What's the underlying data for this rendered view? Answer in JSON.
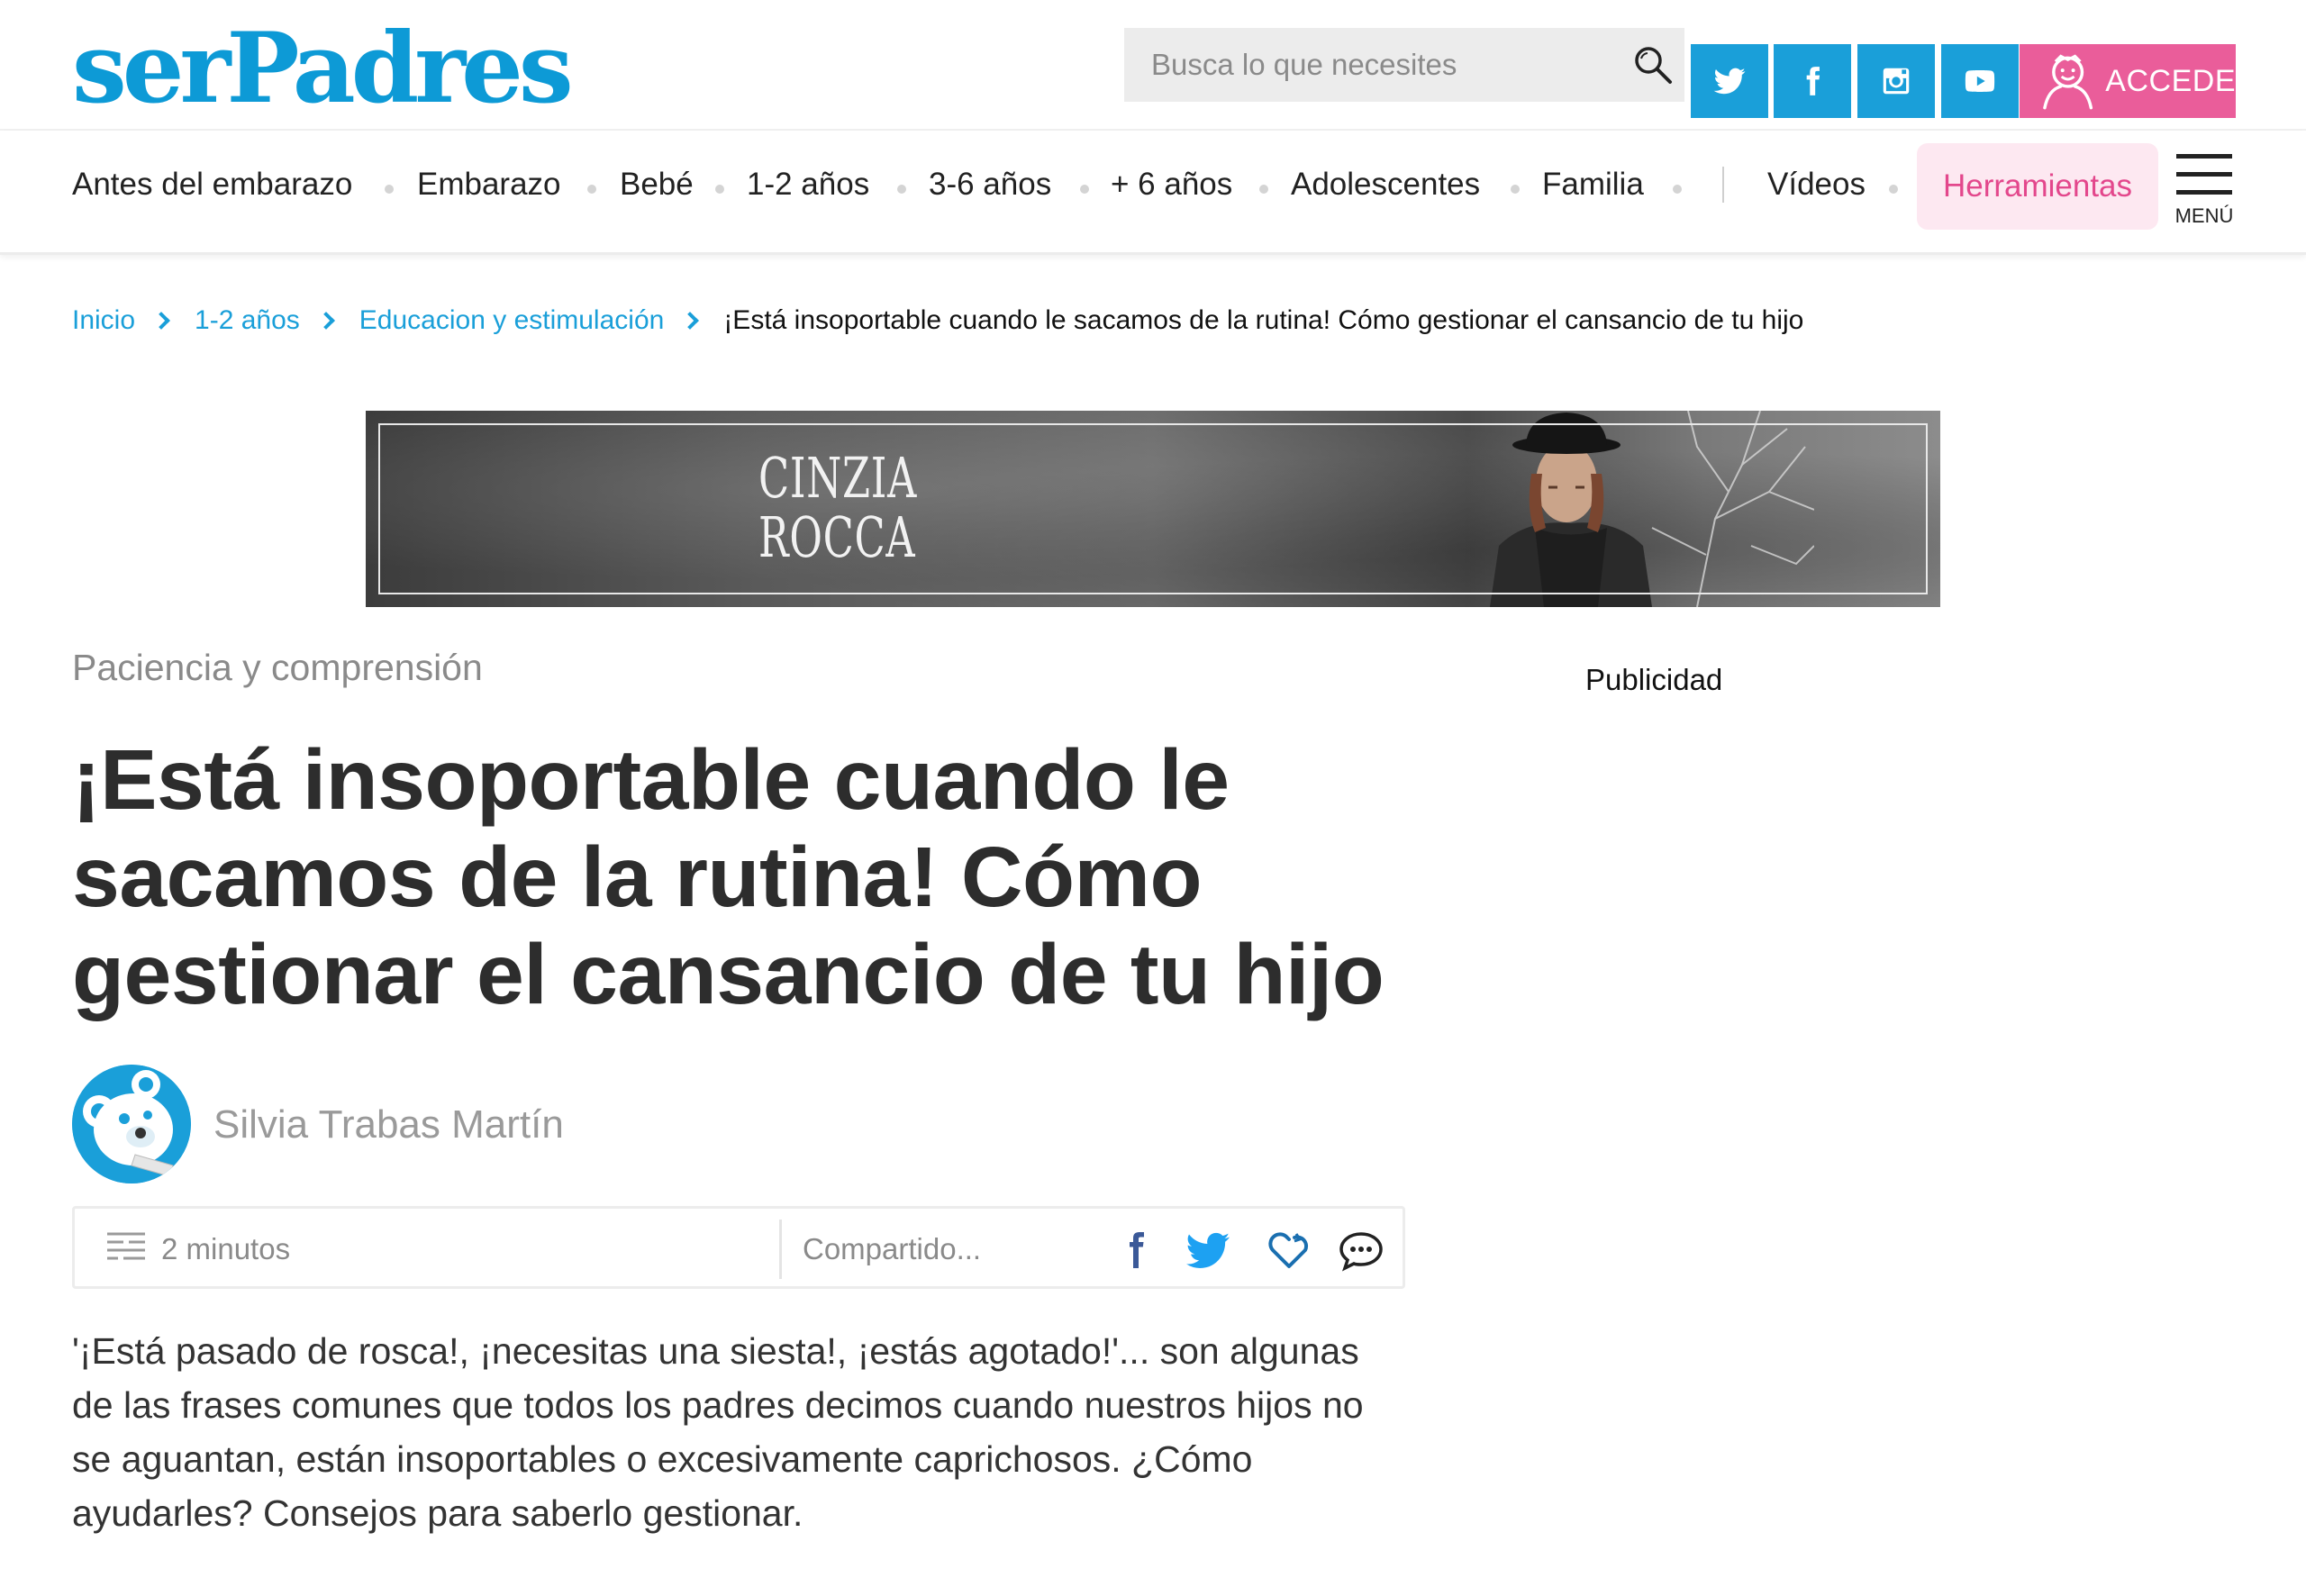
{
  "header": {
    "logo": {
      "part1": "ser",
      "part2": "Padres"
    },
    "search": {
      "placeholder": "Busca lo que necesites"
    },
    "social": [
      {
        "name": "twitter-icon"
      },
      {
        "name": "facebook-icon"
      },
      {
        "name": "instagram-icon"
      },
      {
        "name": "youtube-icon"
      }
    ],
    "login_label": "ACCEDE"
  },
  "nav": {
    "items": [
      "Antes del embarazo",
      "Embarazo",
      "Bebé",
      "1-2 años",
      "3-6 años",
      "+ 6 años",
      "Adolescentes",
      "Familia"
    ],
    "videos": "Vídeos",
    "tools": "Herramientas",
    "menu_label": "MENÚ"
  },
  "breadcrumb": {
    "items": [
      "Inicio",
      "1-2 años",
      "Educacion y estimulación"
    ],
    "current": "¡Está insoportable cuando le sacamos de la rutina! Cómo gestionar el cansancio de tu hijo"
  },
  "ad": {
    "brand_line1": "CINZIA",
    "brand_line2": "ROCCA"
  },
  "article": {
    "kicker": "Paciencia y comprensión",
    "title": "¡Está insoportable cuando le sacamos de la rutina! Cómo gestionar el cansancio de tu hijo",
    "author": "Silvia Trabas Martín",
    "reading_time": "2 minutos",
    "share_label": "Compartido...",
    "lead": "'¡Está pasado de rosca!, ¡necesitas una siesta!, ¡estás agotado!'... son algunas de las frases comunes que todos los padres decimos cuando nuestros hijos no se aguantan, están insoportables o excesivamente caprichosos. ¿Cómo ayudarles? Consejos para saberlo gestionar."
  },
  "sidebar": {
    "ad_label": "Publicidad"
  },
  "colors": {
    "brand_blue": "#1a9fd9",
    "brand_pink": "#ea5d9a",
    "tools_bg": "#fde8f1"
  }
}
